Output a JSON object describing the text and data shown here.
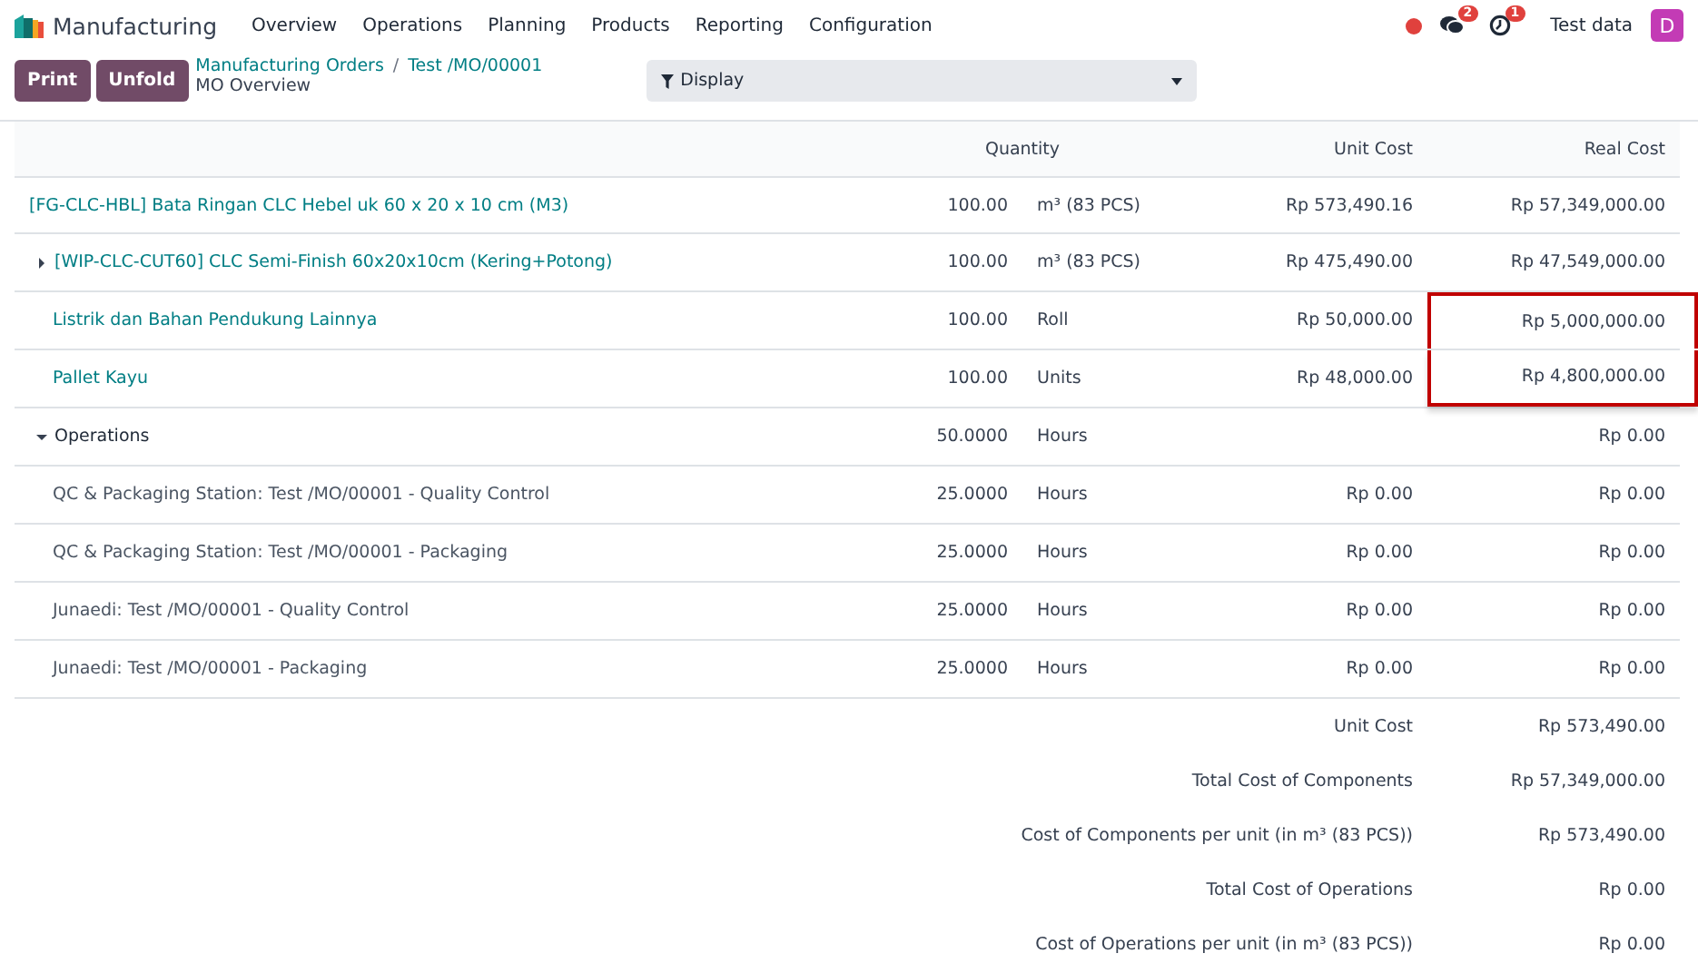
{
  "navbar": {
    "app": "Manufacturing",
    "menu": [
      "Overview",
      "Operations",
      "Planning",
      "Products",
      "Reporting",
      "Configuration"
    ],
    "messages_badge": "2",
    "activities_badge": "1",
    "user": "Test data",
    "avatar": "D"
  },
  "control_panel": {
    "buttons": [
      "Print",
      "Unfold"
    ],
    "breadcrumbs": [
      "Manufacturing Orders",
      "Test /MO/00001"
    ],
    "breadcrumb_separator": "/",
    "subtitle": "MO Overview",
    "display": "Display"
  },
  "table": {
    "columns": [
      "Quantity",
      "Unit Cost",
      "Real Cost"
    ],
    "product": {
      "kind": "product",
      "name": "[FG-CLC-HBL] Bata Ringan CLC Hebel uk 60 x 20 x 10 cm (M3)",
      "quantity": "100.00",
      "uom": "m³ (83 PCS)",
      "unit_cost": "Rp 573,490.16",
      "real_cost": "Rp 57,349,000.00",
      "children": [
        {
          "kind": "product",
          "name": "[WIP-CLC-CUT60] CLC Semi-Finish 60x20x10cm (Kering+Potong)",
          "expanded": false,
          "quantity": "100.00",
          "uom": "m³ (83 PCS)",
          "unit_cost": "Rp 475,490.00",
          "real_cost": "Rp 47,549,000.00",
          "highlighted": false
        },
        {
          "kind": "product",
          "name": "Listrik dan Bahan Pendukung Lainnya",
          "quantity": "100.00",
          "uom": "Roll",
          "unit_cost": "Rp 50,000.00",
          "real_cost": "Rp 5,000,000.00",
          "highlighted": true
        },
        {
          "kind": "product",
          "name": "Pallet Kayu",
          "quantity": "100.00",
          "uom": "Units",
          "unit_cost": "Rp 48,000.00",
          "real_cost": "Rp 4,800,000.00",
          "highlighted": true
        },
        {
          "kind": "section",
          "name": "Operations",
          "expanded": true,
          "quantity": "50.0000",
          "uom": "Hours",
          "real_cost": "Rp 0.00",
          "highlighted": false,
          "children": [
            {
              "kind": "operation",
              "name": "QC & Packaging Station: Test /MO/00001 - Quality Control",
              "quantity": "25.0000",
              "uom": "Hours",
              "unit_cost": "Rp 0.00",
              "real_cost": "Rp 0.00"
            },
            {
              "kind": "operation",
              "name": "QC & Packaging Station: Test /MO/00001 - Packaging",
              "quantity": "25.0000",
              "uom": "Hours",
              "unit_cost": "Rp 0.00",
              "real_cost": "Rp 0.00"
            },
            {
              "kind": "operation",
              "name": "Junaedi: Test /MO/00001 - Quality Control",
              "quantity": "25.0000",
              "uom": "Hours",
              "unit_cost": "Rp 0.00",
              "real_cost": "Rp 0.00"
            },
            {
              "kind": "operation",
              "name": "Junaedi: Test /MO/00001 - Packaging",
              "quantity": "25.0000",
              "uom": "Hours",
              "unit_cost": "Rp 0.00",
              "real_cost": "Rp 0.00"
            }
          ]
        }
      ]
    },
    "summary": [
      {
        "label": "Unit Cost",
        "value": "Rp 573,490.00"
      },
      {
        "label": "Total Cost of Components",
        "value": "Rp 57,349,000.00"
      },
      {
        "label": "Cost of Components per unit (in m³ (83 PCS))",
        "value": "Rp 573,490.00"
      },
      {
        "label": "Total Cost of Operations",
        "value": "Rp 0.00"
      },
      {
        "label": "Cost of Operations per unit (in m³ (83 PCS))",
        "value": "Rp 0.00"
      }
    ]
  }
}
